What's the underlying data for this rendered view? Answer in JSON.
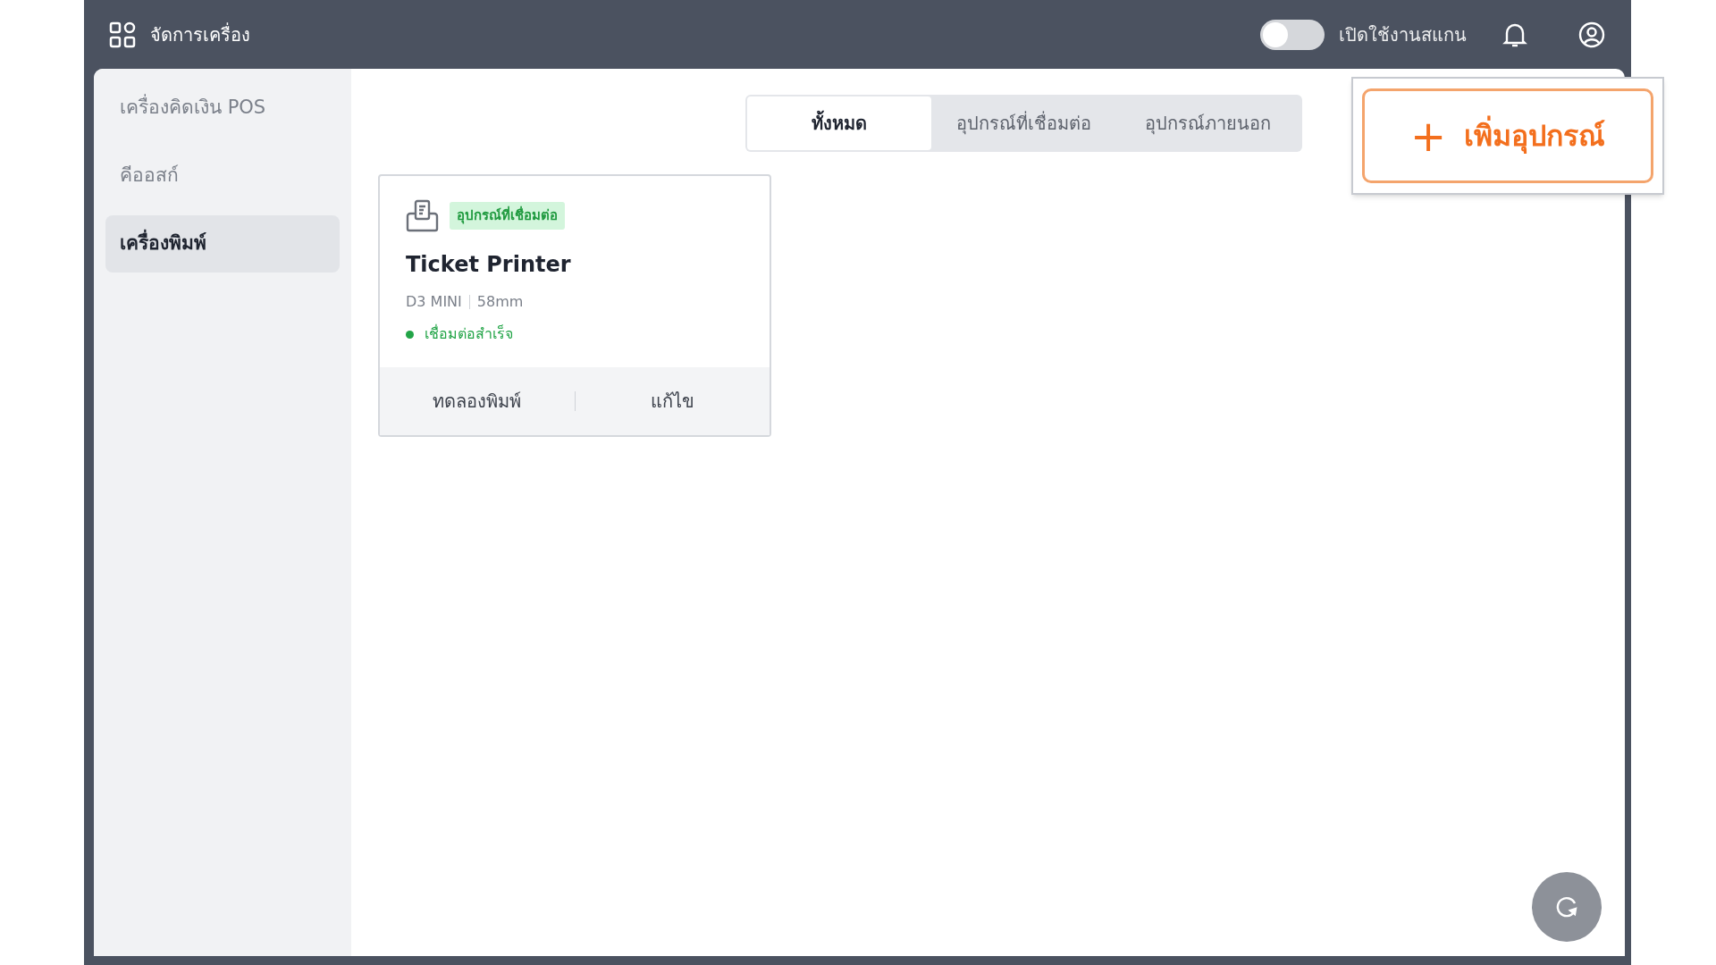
{
  "header": {
    "title": "จัดการเครื่อง",
    "scan_toggle": {
      "label": "เปิดใช้งานสแกน",
      "on": false
    }
  },
  "sidebar": {
    "items": [
      {
        "label": "เครื่องคิดเงิน POS",
        "selected": false
      },
      {
        "label": "คีออสก์",
        "selected": false
      },
      {
        "label": "เครื่องพิมพ์",
        "selected": true
      }
    ]
  },
  "tabs": [
    {
      "label": "ทั้งหมด",
      "selected": true
    },
    {
      "label": "อุปกรณ์ที่เชื่อมต่อ",
      "selected": false
    },
    {
      "label": "อุปกรณ์ภายนอก",
      "selected": false
    }
  ],
  "add_button": {
    "icon": "+",
    "label": "เพิ่มอุปกรณ์"
  },
  "devices": [
    {
      "badge": "อุปกรณ์ที่เชื่อมต่อ",
      "name": "Ticket Printer",
      "model": "D3 MINI",
      "paper": "58mm",
      "status": "เชื่อมต่อสำเร็จ",
      "color": "#22a447",
      "actions": [
        "ทดลองพิมพ์",
        "แก้ไข"
      ]
    }
  ]
}
